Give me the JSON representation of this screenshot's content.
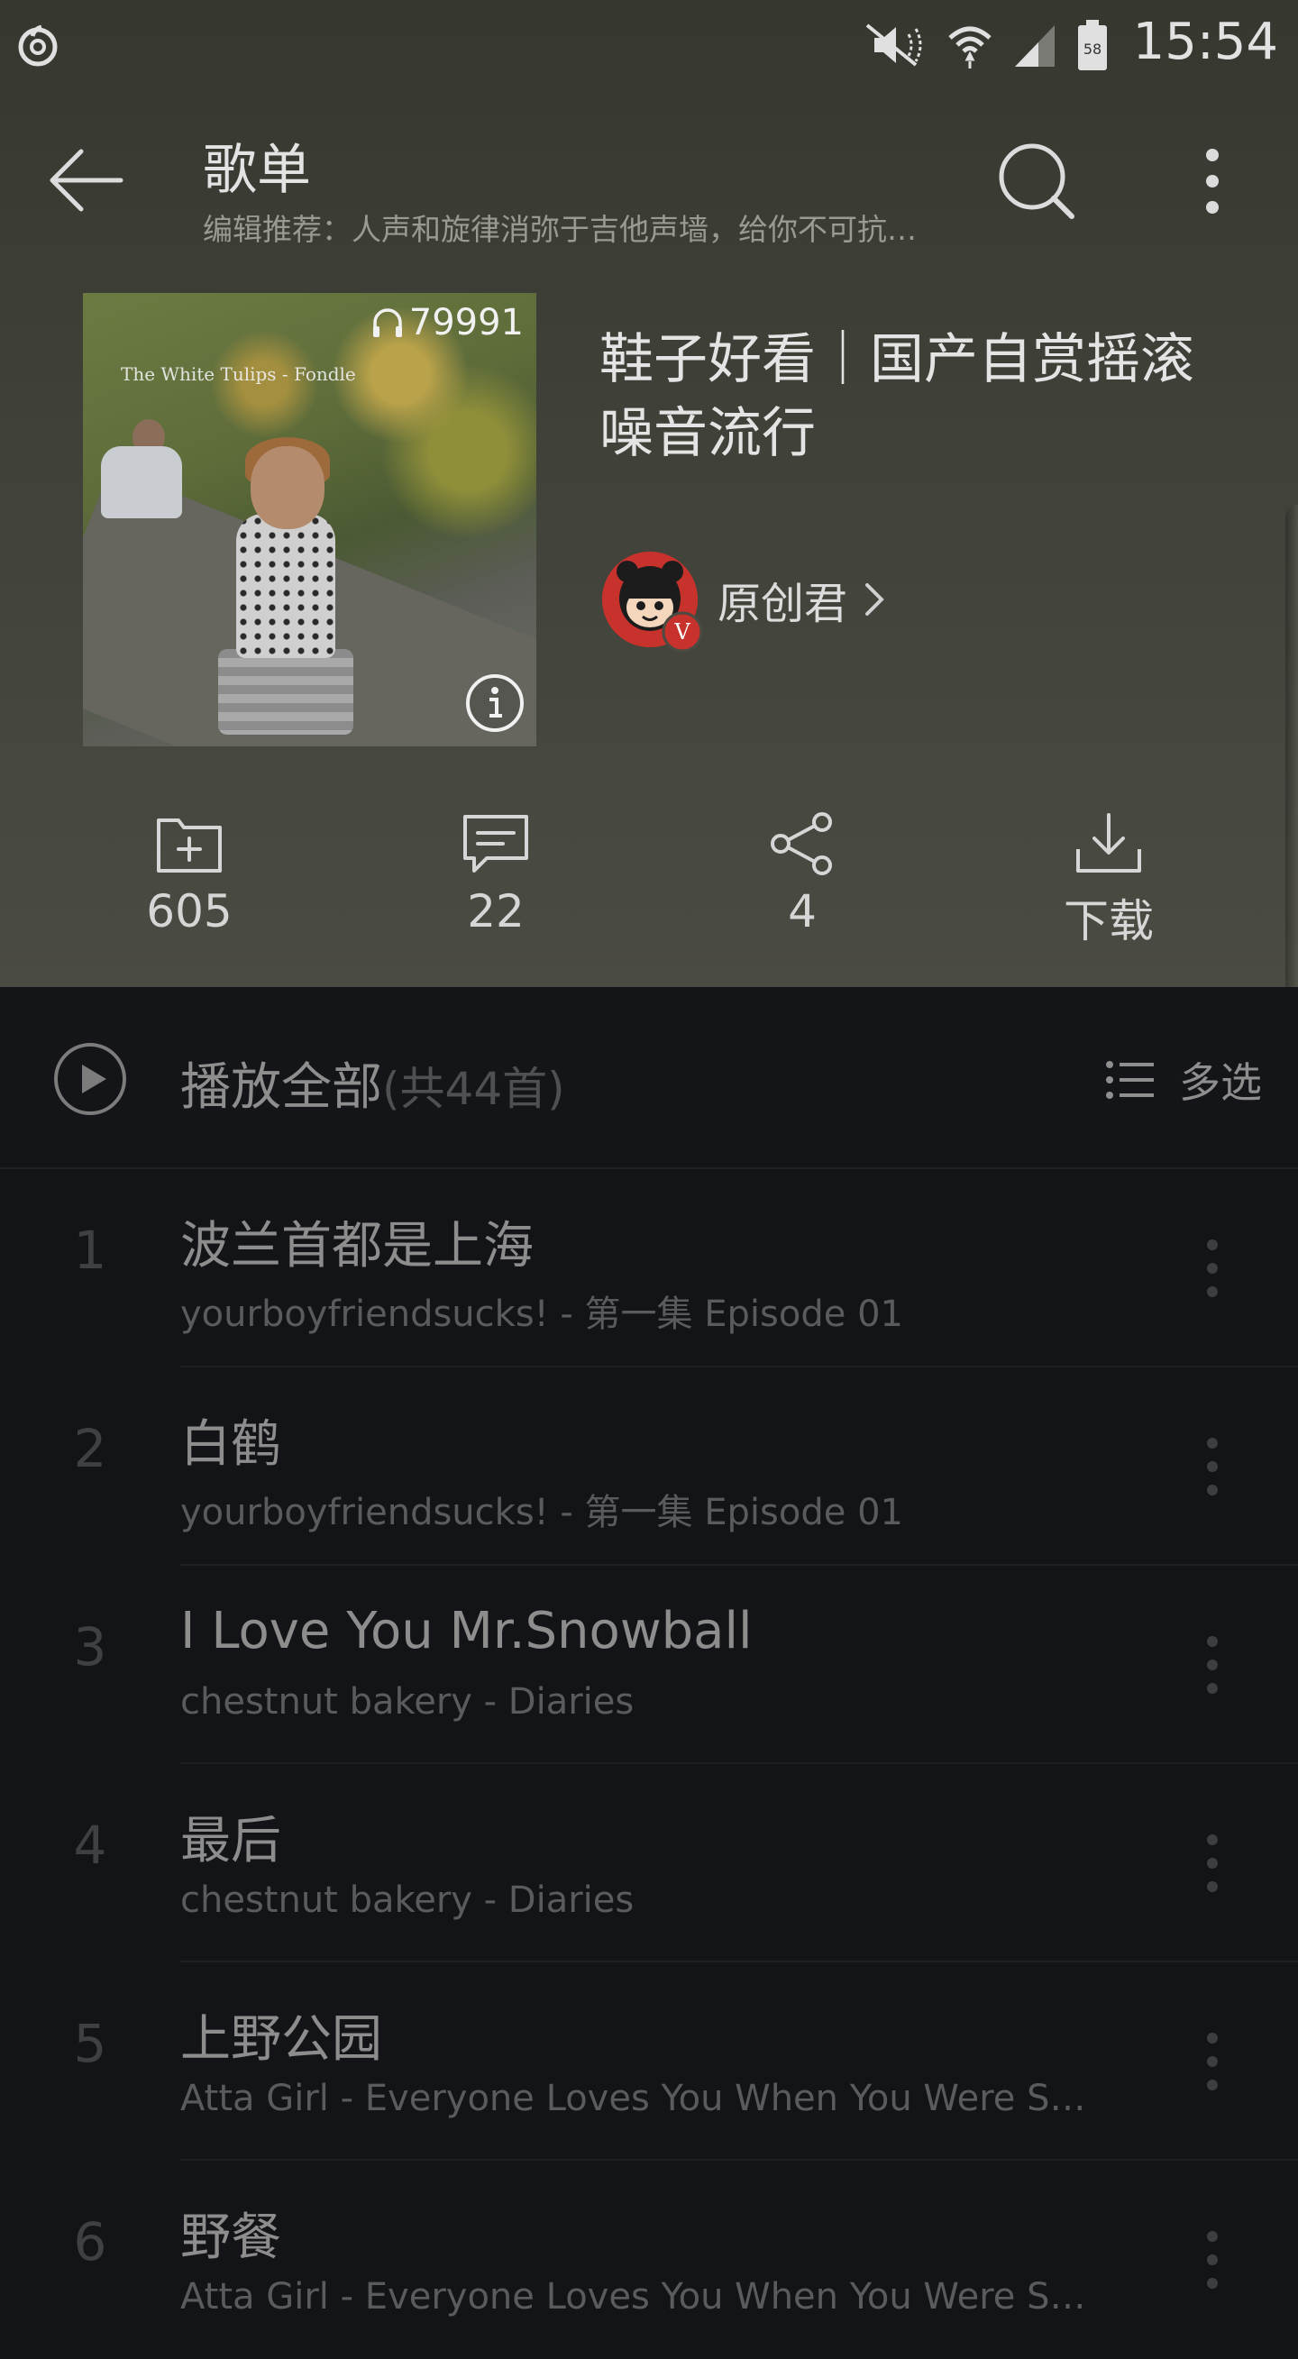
{
  "status_bar": {
    "time": "15:54",
    "battery": "58",
    "icons": [
      "netease-cloud-music-icon",
      "mute-icon",
      "wifi-icon",
      "signal-icon",
      "battery-icon"
    ]
  },
  "toolbar": {
    "title": "歌单",
    "subtitle": "编辑推荐：人声和旋律消弥于吉他声墙，给你不可抗…",
    "icons": [
      "back-arrow-icon",
      "search-icon",
      "more-vertical-icon"
    ]
  },
  "playlist": {
    "cover_text": "The White Tulips - Fondle",
    "play_count": "79991",
    "title": "鞋子好看｜国产自赏摇滚噪音流行",
    "creator_name": "原创君",
    "creator_badge": "V"
  },
  "actions": [
    {
      "icon": "add-to-folder-icon",
      "label": "605"
    },
    {
      "icon": "comment-icon",
      "label": "22"
    },
    {
      "icon": "share-icon",
      "label": "4"
    },
    {
      "icon": "download-icon",
      "label": "下载"
    }
  ],
  "play_all": {
    "label": "播放全部",
    "count": "(共44首)",
    "multiselect_label": "多选"
  },
  "songs": [
    {
      "index": "1",
      "title": "波兰首都是上海",
      "subtitle": "yourboyfriendsucks! - 第一集 Episode 01"
    },
    {
      "index": "2",
      "title": "白鹤",
      "subtitle": "yourboyfriendsucks! - 第一集 Episode 01"
    },
    {
      "index": "3",
      "title": "I Love You Mr.Snowball",
      "subtitle": "chestnut bakery - Diaries"
    },
    {
      "index": "4",
      "title": "最后",
      "subtitle": "chestnut bakery - Diaries"
    },
    {
      "index": "5",
      "title": "上野公园",
      "subtitle": "Atta Girl - Everyone Loves You When You Were Still…"
    },
    {
      "index": "6",
      "title": "野餐",
      "subtitle": "Atta Girl - Everyone Loves You When You Were Still…"
    }
  ],
  "colors": {
    "header_bg": "#40423a",
    "list_bg": "#131417",
    "creator_avatar": "#c8322c"
  }
}
